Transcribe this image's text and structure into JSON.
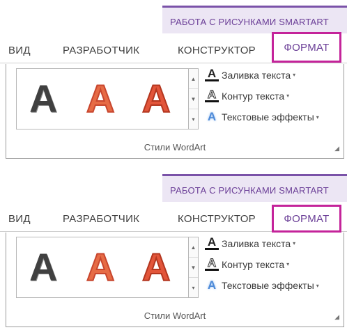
{
  "contextual_tab_group": "РАБОТА С РИСУНКАМИ SMARTART",
  "tabs": {
    "view": "ВИД",
    "developer": "РАЗРАБОТЧИК",
    "design": "КОНСТРУКТОР",
    "format": "ФОРМАТ"
  },
  "gallery": {
    "samples": [
      "A",
      "A",
      "A"
    ],
    "scroll_up": "▲",
    "scroll_down": "▼",
    "more": "▾"
  },
  "commands": {
    "text_fill": "Заливка текста",
    "text_outline": "Контур текста",
    "text_effects": "Текстовые эффекты",
    "dropdown_arrow": "▾",
    "fill_icon_letter": "A",
    "outline_icon_letter": "A",
    "effects_icon_letter": "A"
  },
  "group": {
    "label": "Стили WordArt",
    "launcher": "◢"
  },
  "colors": {
    "context_band": "#ece6f4",
    "context_accent": "#7a52a8",
    "highlight_border": "#c4239a"
  }
}
